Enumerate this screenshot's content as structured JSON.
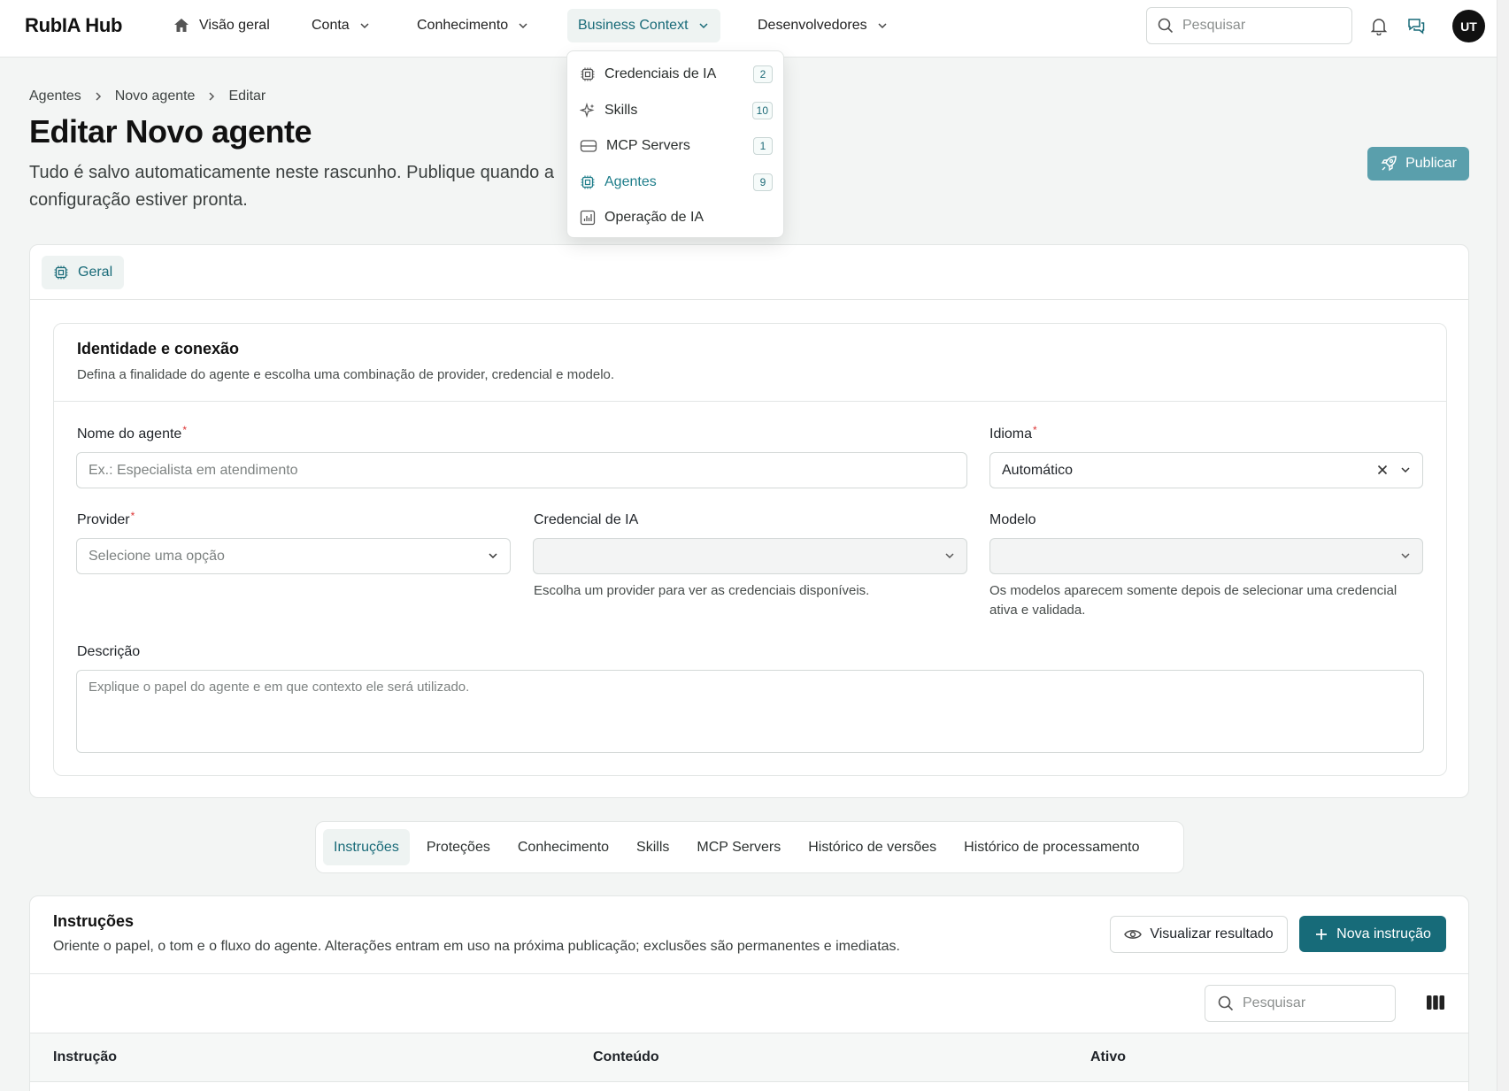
{
  "app": {
    "brand": "RubIA Hub"
  },
  "nav": {
    "items": [
      {
        "label": "Visão geral",
        "icon": "home-icon"
      },
      {
        "label": "Conta",
        "icon": "chevron-down-icon"
      },
      {
        "label": "Conhecimento",
        "icon": "chevron-down-icon"
      },
      {
        "label": "Business Context",
        "icon": "chevron-down-icon",
        "active": true
      },
      {
        "label": "Desenvolvedores",
        "icon": "chevron-down-icon"
      }
    ],
    "search_placeholder": "Pesquisar",
    "avatar_initials": "UT"
  },
  "dropdown": {
    "items": [
      {
        "label": "Credenciais de IA",
        "badge": "2",
        "icon": "chip-icon"
      },
      {
        "label": "Skills",
        "badge": "10",
        "icon": "sparkles-icon"
      },
      {
        "label": "MCP Servers",
        "badge": "1",
        "icon": "server-icon"
      },
      {
        "label": "Agentes",
        "badge": "9",
        "icon": "chip-icon",
        "active": true
      },
      {
        "label": "Operação de IA",
        "badge": "",
        "icon": "chart-icon"
      }
    ]
  },
  "breadcrumb": {
    "items": [
      "Agentes",
      "Novo agente",
      "Editar"
    ]
  },
  "header": {
    "title": "Editar Novo agente",
    "subtitle": "Tudo é salvo automaticamente neste rascunho. Publique quando a configuração estiver pronta.",
    "publish_label": "Publicar"
  },
  "card": {
    "tab_label": "Geral",
    "section_title": "Identidade e conexão",
    "section_desc": "Defina a finalidade do agente e escolha uma combinação de provider, credencial e modelo.",
    "fields": {
      "name": {
        "label": "Nome do agente",
        "placeholder": "Ex.: Especialista em atendimento"
      },
      "language": {
        "label": "Idioma",
        "value": "Automático"
      },
      "provider": {
        "label": "Provider",
        "placeholder": "Selecione uma opção"
      },
      "credential": {
        "label": "Credencial de IA",
        "help": "Escolha um provider para ver as credenciais disponíveis."
      },
      "model": {
        "label": "Modelo",
        "help": "Os modelos aparecem somente depois de selecionar uma credencial ativa e validada."
      },
      "description": {
        "label": "Descrição",
        "placeholder": "Explique o papel do agente e em que contexto ele será utilizado."
      }
    }
  },
  "subtabs": [
    "Instruções",
    "Proteções",
    "Conhecimento",
    "Skills",
    "MCP Servers",
    "Histórico de versões",
    "Histórico de processamento"
  ],
  "instructions": {
    "title": "Instruções",
    "desc": "Oriente o papel, o tom e o fluxo do agente. Alterações entram em uso na próxima publicação; exclusões são permanentes e imediatas.",
    "preview_label": "Visualizar resultado",
    "new_label": "Nova instrução",
    "search_placeholder": "Pesquisar",
    "columns": [
      "Instrução",
      "Conteúdo",
      "Ativo"
    ]
  },
  "colors": {
    "accent": "#176b79",
    "accent_soft": "#5a9fac",
    "active_bg": "#eef3f2"
  }
}
